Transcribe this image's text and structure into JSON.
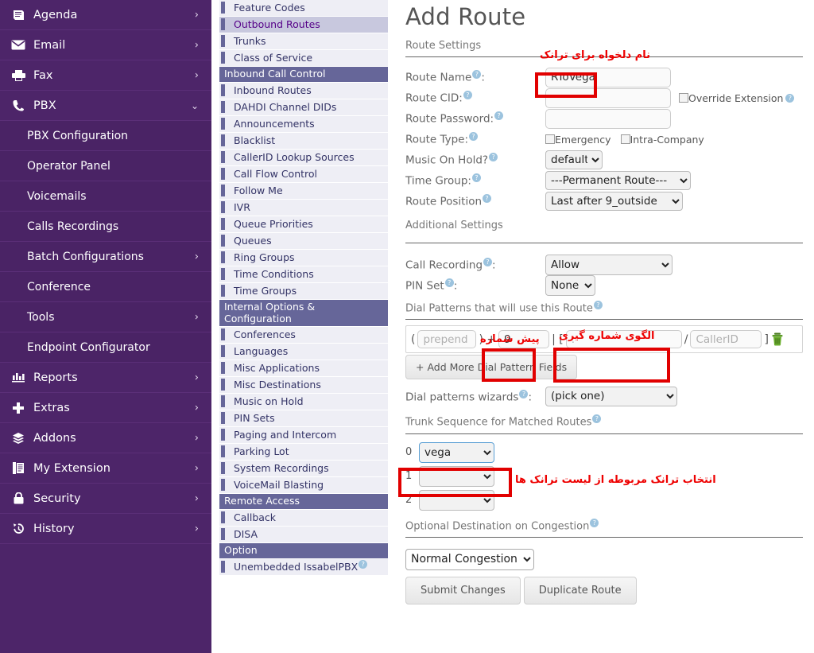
{
  "sidebar": {
    "items": [
      {
        "label": "Agenda",
        "icon": "agenda-icon",
        "chevron": "right",
        "sub": false
      },
      {
        "label": "Email",
        "icon": "email-icon",
        "chevron": "right",
        "sub": false
      },
      {
        "label": "Fax",
        "icon": "fax-icon",
        "chevron": "right",
        "sub": false
      },
      {
        "label": "PBX",
        "icon": "phone-icon",
        "chevron": "down",
        "sub": false
      },
      {
        "label": "PBX Configuration",
        "icon": "",
        "chevron": "",
        "sub": true
      },
      {
        "label": "Operator Panel",
        "icon": "",
        "chevron": "",
        "sub": true
      },
      {
        "label": "Voicemails",
        "icon": "",
        "chevron": "",
        "sub": true
      },
      {
        "label": "Calls Recordings",
        "icon": "",
        "chevron": "",
        "sub": true
      },
      {
        "label": "Batch Configurations",
        "icon": "",
        "chevron": "right",
        "sub": true
      },
      {
        "label": "Conference",
        "icon": "",
        "chevron": "",
        "sub": true
      },
      {
        "label": "Tools",
        "icon": "",
        "chevron": "right",
        "sub": true
      },
      {
        "label": "Endpoint Configurator",
        "icon": "",
        "chevron": "",
        "sub": true
      },
      {
        "label": "Reports",
        "icon": "reports-icon",
        "chevron": "right",
        "sub": false
      },
      {
        "label": "Extras",
        "icon": "plus-icon",
        "chevron": "right",
        "sub": false
      },
      {
        "label": "Addons",
        "icon": "addons-icon",
        "chevron": "right",
        "sub": false
      },
      {
        "label": "My Extension",
        "icon": "document-icon",
        "chevron": "right",
        "sub": false
      },
      {
        "label": "Security",
        "icon": "lock-icon",
        "chevron": "right",
        "sub": false
      },
      {
        "label": "History",
        "icon": "history-icon",
        "chevron": "right",
        "sub": false
      }
    ]
  },
  "menu": {
    "entries": [
      {
        "type": "item",
        "label": "Feature Codes",
        "active": false
      },
      {
        "type": "item",
        "label": "Outbound Routes",
        "active": true
      },
      {
        "type": "item",
        "label": "Trunks",
        "active": false
      },
      {
        "type": "item",
        "label": "Class of Service",
        "active": false
      },
      {
        "type": "head",
        "label": "Inbound Call Control"
      },
      {
        "type": "item",
        "label": "Inbound Routes",
        "active": false
      },
      {
        "type": "item",
        "label": "DAHDI Channel DIDs",
        "active": false
      },
      {
        "type": "item",
        "label": "Announcements",
        "active": false
      },
      {
        "type": "item",
        "label": "Blacklist",
        "active": false
      },
      {
        "type": "item",
        "label": "CallerID Lookup Sources",
        "active": false
      },
      {
        "type": "item",
        "label": "Call Flow Control",
        "active": false
      },
      {
        "type": "item",
        "label": "Follow Me",
        "active": false
      },
      {
        "type": "item",
        "label": "IVR",
        "active": false
      },
      {
        "type": "item",
        "label": "Queue Priorities",
        "active": false
      },
      {
        "type": "item",
        "label": "Queues",
        "active": false
      },
      {
        "type": "item",
        "label": "Ring Groups",
        "active": false
      },
      {
        "type": "item",
        "label": "Time Conditions",
        "active": false
      },
      {
        "type": "item",
        "label": "Time Groups",
        "active": false
      },
      {
        "type": "head",
        "label": "Internal Options & Configuration"
      },
      {
        "type": "item",
        "label": "Conferences",
        "active": false
      },
      {
        "type": "item",
        "label": "Languages",
        "active": false
      },
      {
        "type": "item",
        "label": "Misc Applications",
        "active": false
      },
      {
        "type": "item",
        "label": "Misc Destinations",
        "active": false
      },
      {
        "type": "item",
        "label": "Music on Hold",
        "active": false
      },
      {
        "type": "item",
        "label": "PIN Sets",
        "active": false
      },
      {
        "type": "item",
        "label": "Paging and Intercom",
        "active": false
      },
      {
        "type": "item",
        "label": "Parking Lot",
        "active": false
      },
      {
        "type": "item",
        "label": "System Recordings",
        "active": false
      },
      {
        "type": "item",
        "label": "VoiceMail Blasting",
        "active": false
      },
      {
        "type": "head",
        "label": "Remote Access"
      },
      {
        "type": "item",
        "label": "Callback",
        "active": false
      },
      {
        "type": "item",
        "label": "DISA",
        "active": false
      },
      {
        "type": "head",
        "label": "Option"
      },
      {
        "type": "item",
        "label": "Unembedded IssabelPBX",
        "active": false,
        "help": true
      }
    ]
  },
  "main": {
    "title": "Add Route",
    "route_settings_label": "Route Settings",
    "additional_settings_label": "Additional Settings",
    "labels": {
      "route_name": "Route Name",
      "route_cid": "Route CID:",
      "route_password": "Route Password:",
      "route_type": "Route Type:",
      "music_on_hold": "Music On Hold?",
      "time_group": "Time Group:",
      "route_position": "Route Position",
      "call_recording": "Call Recording",
      "pin_set": "PIN Set",
      "dial_patterns_title": "Dial Patterns that will use this Route",
      "dial_patterns_wizards": "Dial patterns wizards",
      "trunk_sequence": "Trunk Sequence for Matched Routes",
      "optional_destination": "Optional Destination on Congestion",
      "colon": ":"
    },
    "values": {
      "route_name": "RToVega",
      "route_cid": "",
      "route_password": "",
      "override_extension": "Override Extension",
      "emergency": "Emergency",
      "intra_company": "Intra-Company",
      "music_on_hold": "default",
      "time_group": "---Permanent Route---",
      "route_position": "Last after 9_outside",
      "call_recording": "Allow",
      "pin_set": "None",
      "dial_prepend_placeholder": "prepend",
      "dial_prefix": "9",
      "dial_match_placeholder": ".",
      "dial_match": "",
      "dial_callerid_placeholder": "CallerID",
      "add_more_fields": "+ Add More Dial Pattern Fields",
      "dial_wizard": "(pick one)",
      "congestion_destination": "Normal Congestion"
    },
    "trunks": [
      {
        "index": "0",
        "value": "vega",
        "selected": true
      },
      {
        "index": "1",
        "value": "",
        "selected": false
      },
      {
        "index": "2",
        "value": "",
        "selected": false
      }
    ],
    "buttons": {
      "submit": "Submit Changes",
      "duplicate": "Duplicate Route"
    }
  },
  "annotations": [
    {
      "name": "route-name-note",
      "text": "نام دلخواه برای ترانک"
    },
    {
      "name": "prefix-note",
      "text": "پیش شماره"
    },
    {
      "name": "dial-pattern-note",
      "text": "الگوی شماره گیری"
    },
    {
      "name": "trunk-note",
      "text": "انتخاب ترانک مربوطه از لیست ترانک ها"
    }
  ],
  "colors": {
    "sidebar_bg": "#4d2569",
    "menu_head_bg": "#666699",
    "menu_item_bg": "#eeeef5",
    "menu_active_bg": "#c8c8de",
    "annotation_red": "#ee0000",
    "highlight_border": "#e10000"
  }
}
